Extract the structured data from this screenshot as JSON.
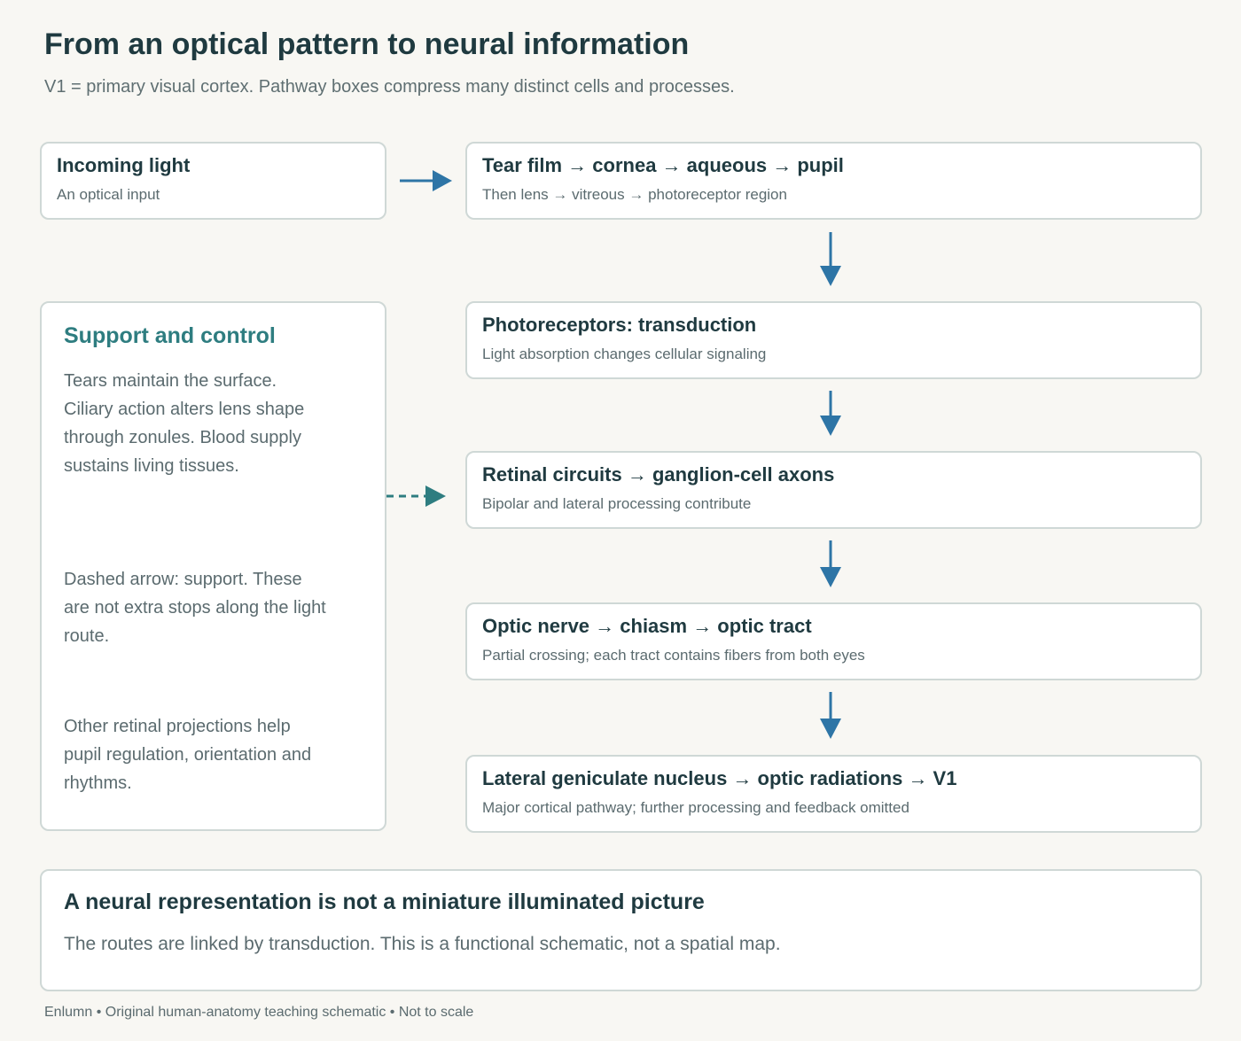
{
  "header": {
    "title": "From an optical pattern to neural information",
    "subtitle": "V1 = primary visual cortex. Pathway boxes compress many distinct cells and processes."
  },
  "input": {
    "title": "Incoming light",
    "subtitle": "An optical input"
  },
  "pathway": [
    {
      "title": "Tear film → cornea → aqueous → pupil",
      "subtitle": "Then lens → vitreous → photoreceptor region"
    },
    {
      "title": "Photoreceptors: transduction",
      "subtitle": "Light absorption changes cellular signaling"
    },
    {
      "title": "Retinal circuits → ganglion-cell axons",
      "subtitle": "Bipolar and lateral processing contribute"
    },
    {
      "title": "Optic nerve → chiasm → optic tract",
      "subtitle": "Partial crossing; each tract contains fibers from both eyes"
    },
    {
      "title": "Lateral geniculate nucleus → optic radiations → V1",
      "subtitle": "Major cortical pathway; further processing and feedback omitted"
    }
  ],
  "support": {
    "title": "Support and control",
    "para1": "Tears maintain the surface. Ciliary action alters lens shape through zonules. Blood supply sustains living tissues.",
    "para2": "Dashed arrow: support. These are not extra stops along the light route.",
    "para3": "Other retinal projections help pupil regulation, orientation and rhythms."
  },
  "conclusion": {
    "title": "A neural representation is not a miniature illuminated picture",
    "text": "The routes are linked by transduction. This is a functional schematic, not a spatial map."
  },
  "footer": "Enlumn • Original human-anatomy teaching schematic • Not to scale",
  "colors": {
    "background": "#f8f7f3",
    "arrow_main": "#2e75a6",
    "arrow_support": "#2e7d80",
    "support_title": "#2e7d80",
    "box_border": "#cfd8d6"
  }
}
